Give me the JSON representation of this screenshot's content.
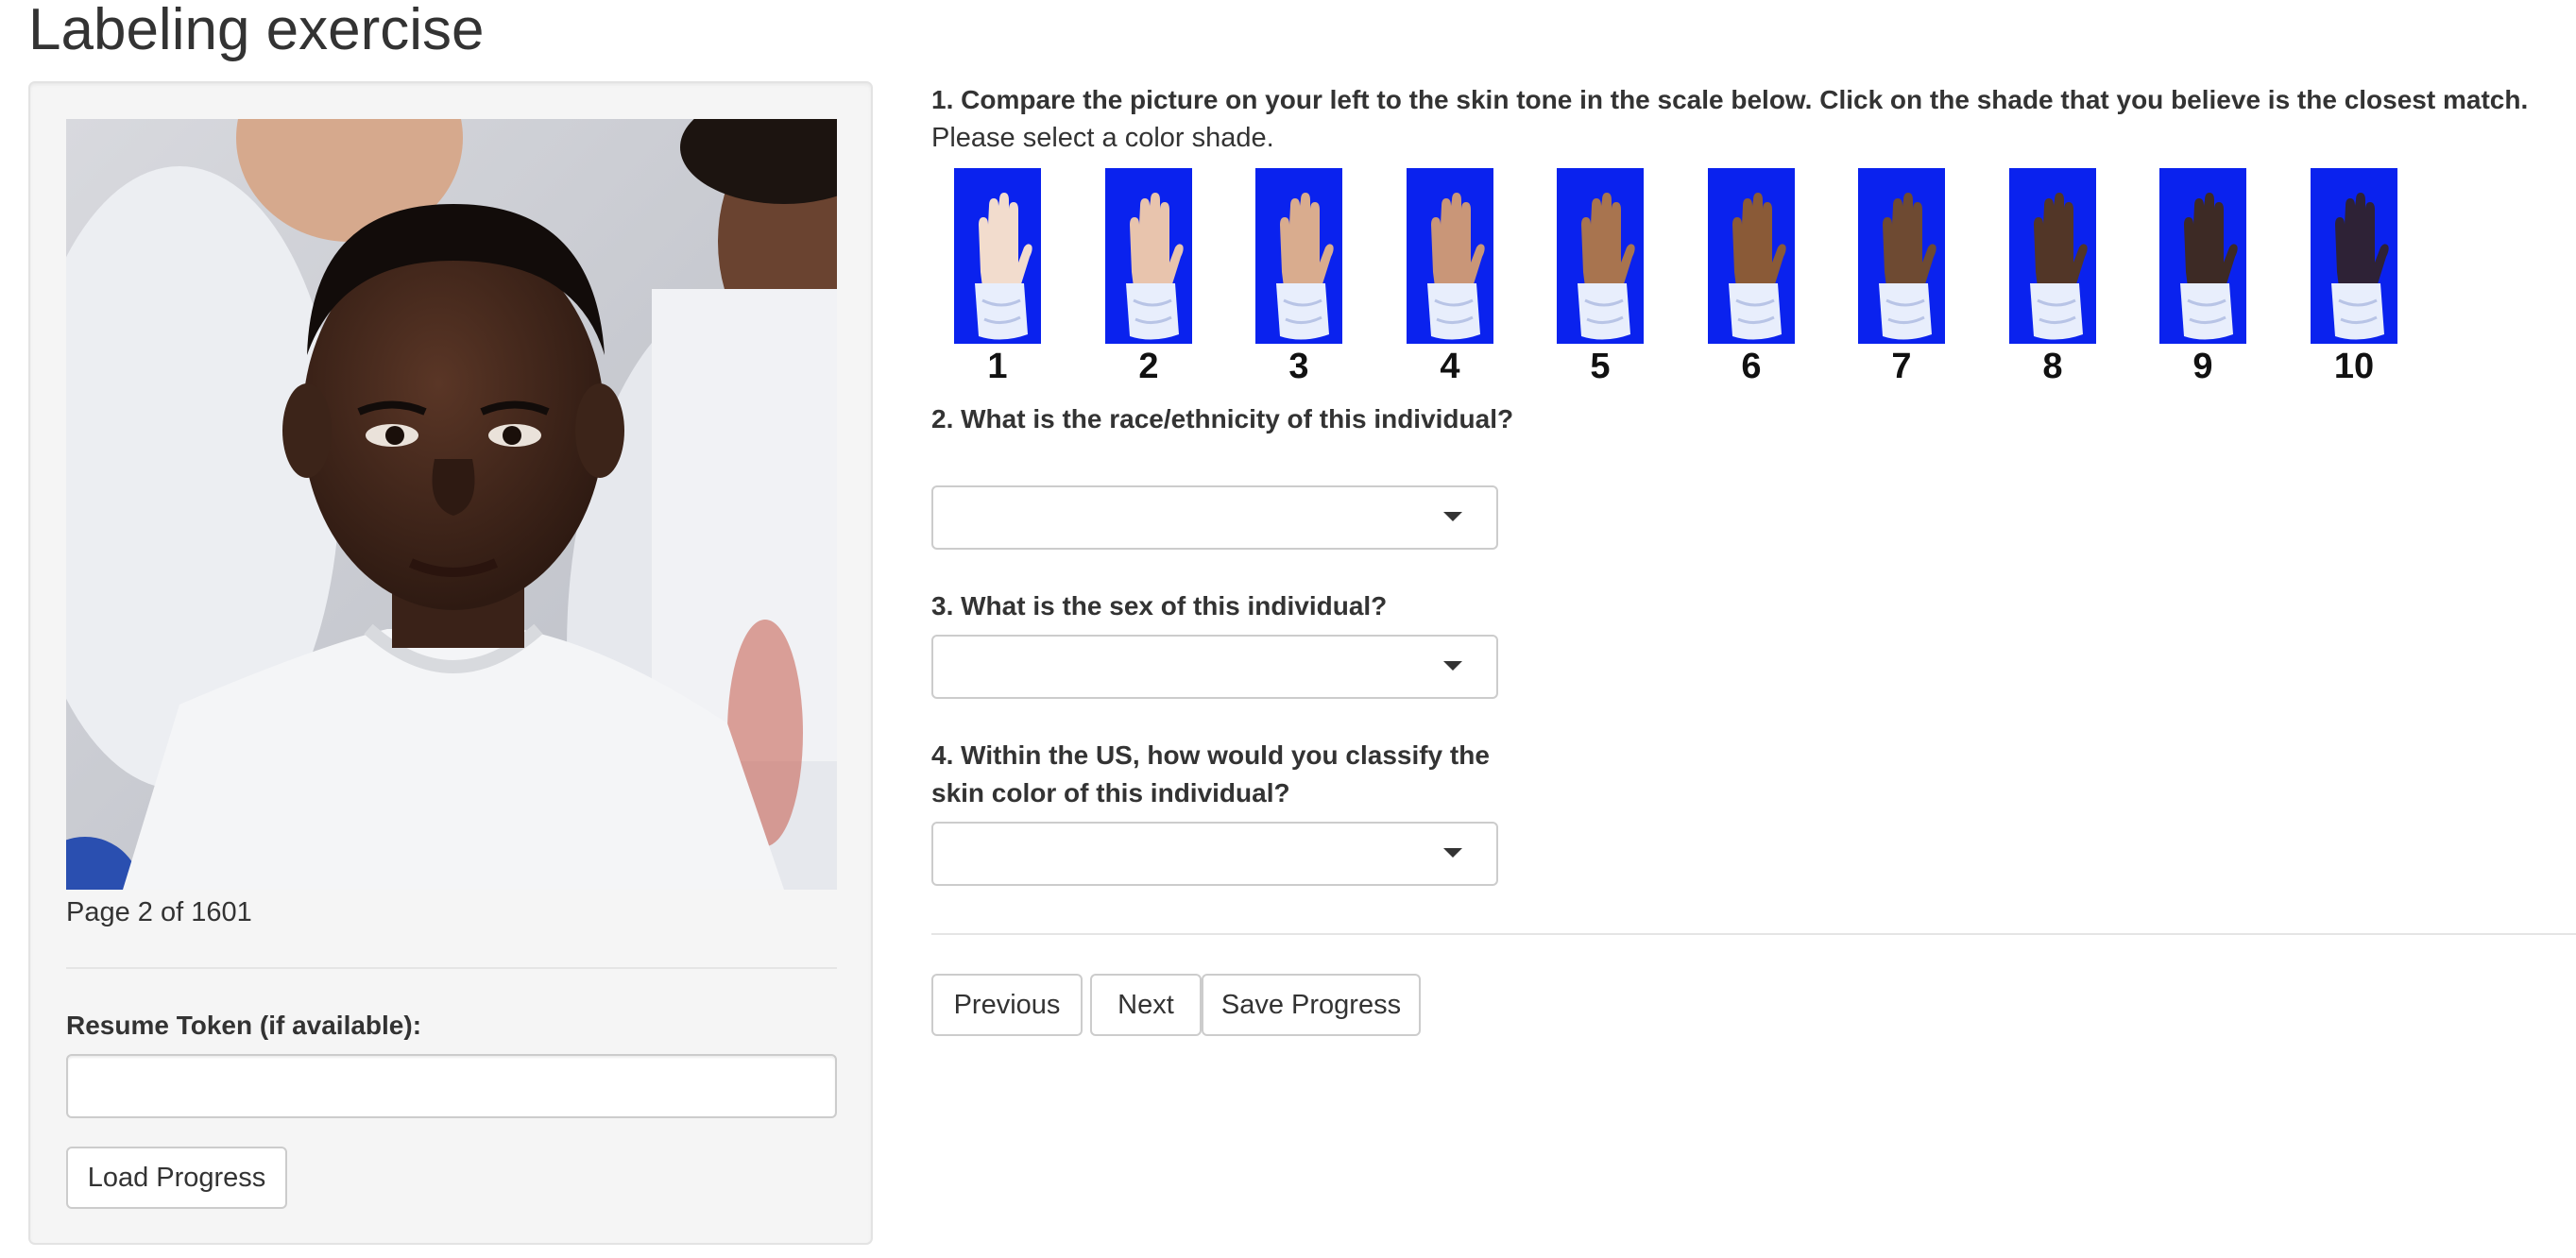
{
  "page": {
    "title": "Labeling exercise"
  },
  "left_panel": {
    "photo_alt": "portrait-photo",
    "page_indicator": "Page 2 of 1601",
    "resume_token": {
      "label": "Resume Token (if available):",
      "value": "",
      "placeholder": ""
    },
    "load_button": "Load Progress"
  },
  "question1": {
    "text": "1. Compare the picture on your left to the skin tone in the scale below. Click on the shade that you believe is the closest match.",
    "subtext": "Please select a color shade.",
    "shades": [
      {
        "label": "1",
        "skin": "#f2dccd"
      },
      {
        "label": "2",
        "skin": "#e8c4ad"
      },
      {
        "label": "3",
        "skin": "#d9ac8e"
      },
      {
        "label": "4",
        "skin": "#c99678"
      },
      {
        "label": "5",
        "skin": "#a8744f"
      },
      {
        "label": "6",
        "skin": "#8a5a37"
      },
      {
        "label": "7",
        "skin": "#6e4a32"
      },
      {
        "label": "8",
        "skin": "#523627"
      },
      {
        "label": "9",
        "skin": "#3d2a25"
      },
      {
        "label": "10",
        "skin": "#2e2236"
      }
    ],
    "card_color": "#0a22ee"
  },
  "question2": {
    "label": "2. What is the race/ethnicity of this individual?",
    "selected": ""
  },
  "question3": {
    "label": "3. What is the sex of this individual?",
    "selected": ""
  },
  "question4": {
    "label": "4. Within the US, how would you classify the skin color of this individual?",
    "selected": ""
  },
  "nav": {
    "previous": "Previous",
    "next": "Next",
    "save": "Save Progress"
  }
}
